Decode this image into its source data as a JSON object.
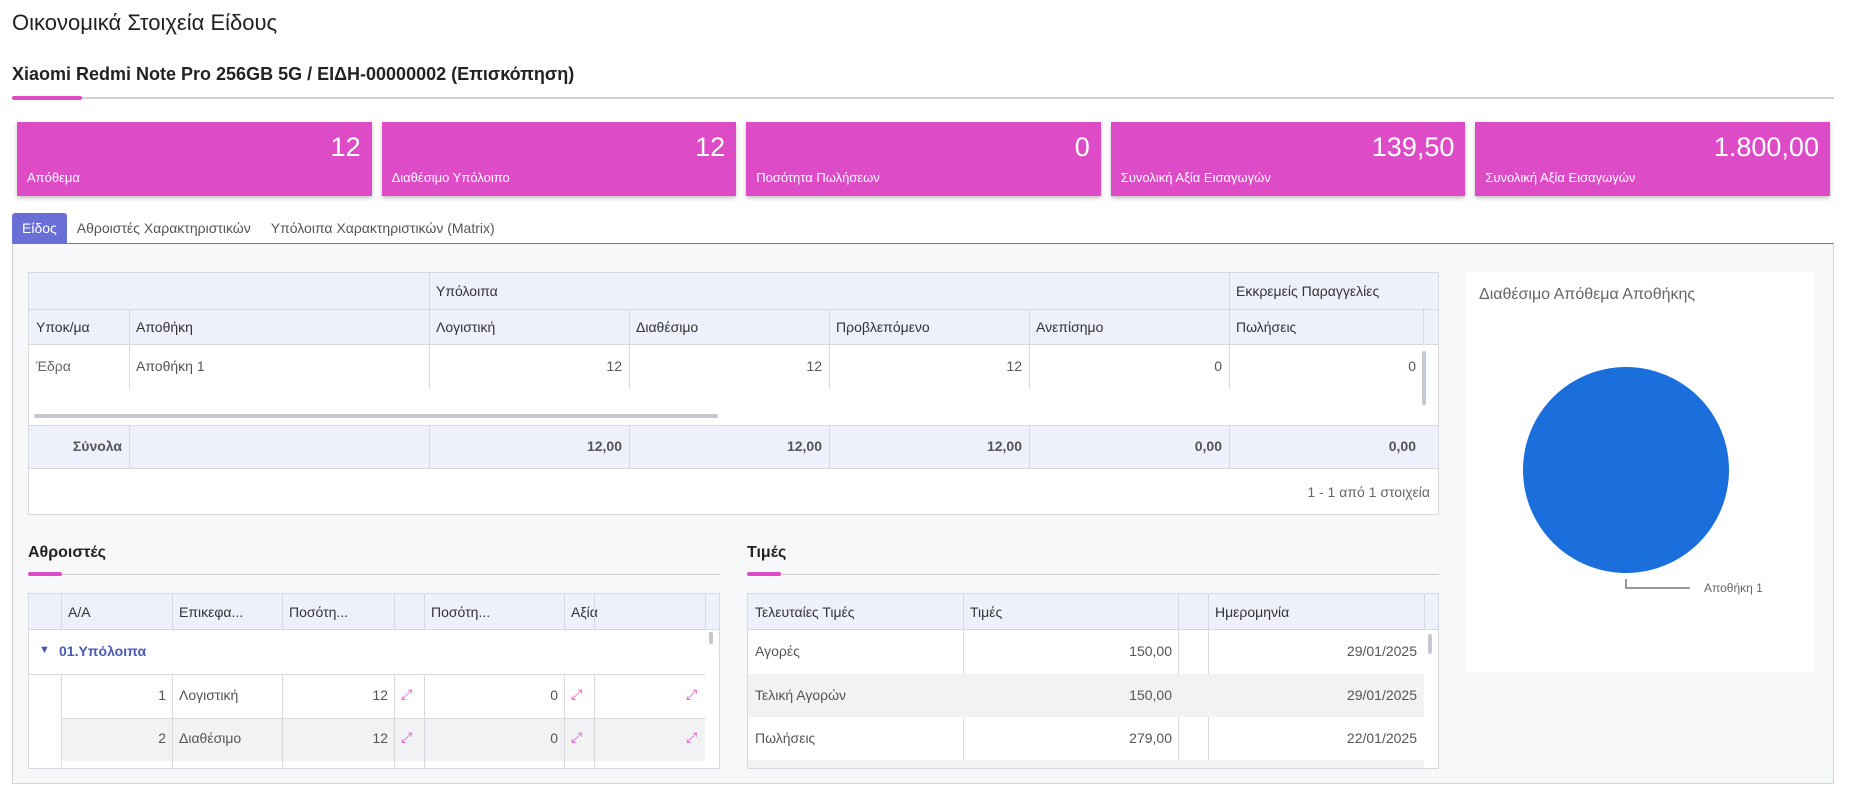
{
  "page": {
    "title": "Οικονομικά Στοιχεία Είδους",
    "subtitle": "Xiaomi Redmi Note Pro 256GB 5G / ΕΙΔΗ-00000002 (Επισκόπηση)"
  },
  "cards": [
    {
      "value": "12",
      "label": "Απόθεμα"
    },
    {
      "value": "12",
      "label": "Διαθέσιμο Υπόλοιπο"
    },
    {
      "value": "0",
      "label": "Ποσότητα Πωλήσεων"
    },
    {
      "value": "139,50",
      "label": "Συνολική Αξία Εισαγωγών"
    },
    {
      "value": "1.800,00",
      "label": "Συνολική Αξία Εισαγωγών"
    }
  ],
  "tabs": [
    {
      "label": "Είδος",
      "active": true
    },
    {
      "label": "Αθροιστές Χαρακτηριστικών",
      "active": false
    },
    {
      "label": "Υπόλοιπα Χαρακτηριστικών (Matrix)",
      "active": false
    }
  ],
  "balances_grid": {
    "group_headers": {
      "balances": "Υπόλοιπα",
      "pending": "Εκκρεμείς Παραγγελίες"
    },
    "columns": [
      "Υποκ/μα",
      "Αποθήκη",
      "Λογιστική",
      "Διαθέσιμο",
      "Προβλεπόμενο",
      "Ανεπίσημο",
      "Πωλήσεις"
    ],
    "rows": [
      [
        "Έδρα",
        "Αποθήκη 1",
        "12",
        "12",
        "12",
        "0",
        "0"
      ]
    ],
    "totals_label": "Σύνολα",
    "totals": [
      "12,00",
      "12,00",
      "12,00",
      "0,00",
      "0,00"
    ],
    "pager": "1 - 1 από 1 στοιχεία"
  },
  "accumulators": {
    "title": "Αθροιστές",
    "columns": [
      "Α/Α",
      "Επικεφα...",
      "Ποσότη...",
      "Ποσότη...",
      "Αξία"
    ],
    "group": "01.Υπόλοιπα",
    "rows": [
      {
        "aa": "1",
        "header": "Λογιστική",
        "qty1": "12",
        "qty2": "0"
      },
      {
        "aa": "2",
        "header": "Διαθέσιμο",
        "qty1": "12",
        "qty2": "0"
      }
    ]
  },
  "prices": {
    "title": "Τιμές",
    "columns": [
      "Τελευταίες Τιμές",
      "Τιμές",
      "Ημερομηνία"
    ],
    "rows": [
      {
        "label": "Αγορές",
        "price": "150,00",
        "date": "29/01/2025"
      },
      {
        "label": "Τελική Αγορών",
        "price": "150,00",
        "date": "29/01/2025"
      },
      {
        "label": "Πωλήσεις",
        "price": "279,00",
        "date": "22/01/2025"
      }
    ]
  },
  "chart_data": {
    "type": "pie",
    "title": "Διαθέσιμο Απόθεμα Αποθήκης",
    "categories": [
      "Αποθήκη 1"
    ],
    "values": [
      12
    ],
    "colors": [
      "#1a6fdc"
    ]
  },
  "colors": {
    "accent": "#dd4bc7",
    "tab_active": "#6a6fd6",
    "pie": "#1a6fdc"
  },
  "icons": {
    "expand": "expand-diagonal-icon",
    "collapse": "triangle-down-icon"
  }
}
